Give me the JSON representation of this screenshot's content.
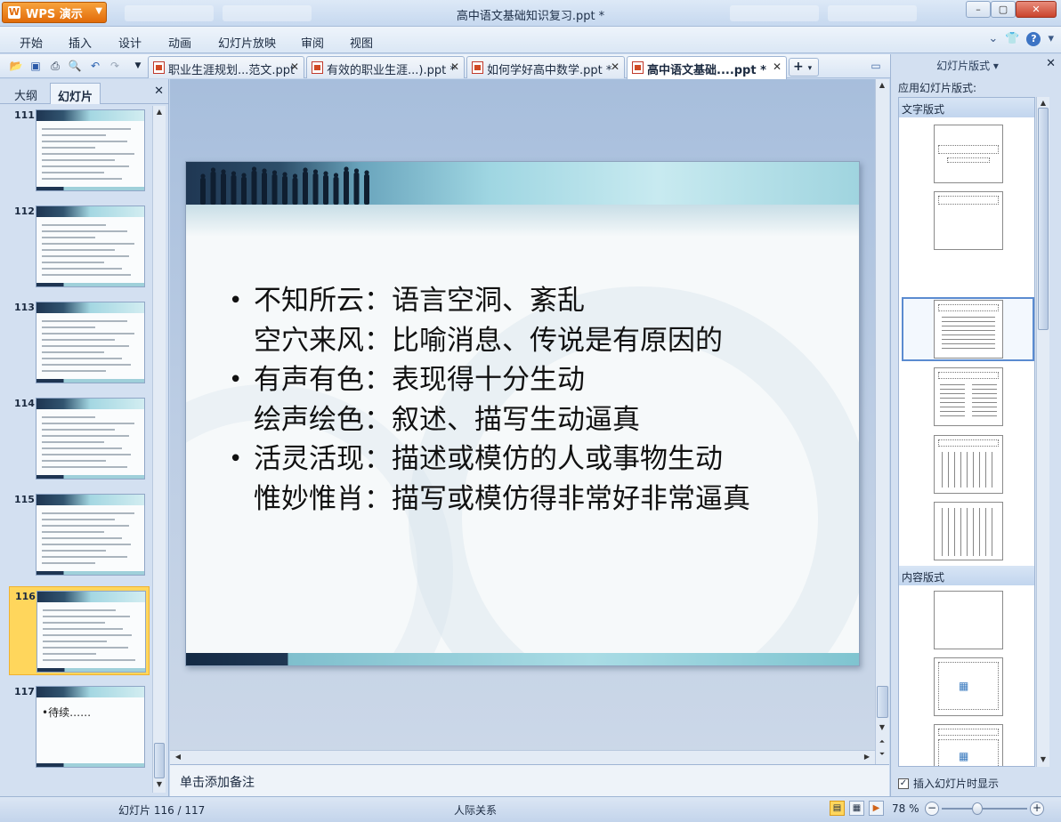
{
  "app": {
    "brand": "WPS 演示",
    "window_title": "高中语文基础知识复习.ppt *"
  },
  "window_controls": {
    "minimize": "–",
    "restore": "▢",
    "close": "✕"
  },
  "menu": {
    "items": [
      "开始",
      "插入",
      "设计",
      "动画",
      "幻灯片放映",
      "审阅",
      "视图"
    ]
  },
  "doc_tabs": [
    {
      "label": "职业生涯规划...范文.ppt",
      "active": false
    },
    {
      "label": "有效的职业生涯...).ppt *",
      "active": false
    },
    {
      "label": "如何学好高中数学.ppt *",
      "active": false
    },
    {
      "label": "高中语文基础....ppt *",
      "active": true
    }
  ],
  "left_panel": {
    "tabs": [
      "大纲",
      "幻灯片"
    ],
    "active_tab": "幻灯片",
    "thumbnails": [
      {
        "number": "111",
        "selected": false,
        "text": ""
      },
      {
        "number": "112",
        "selected": false,
        "text": ""
      },
      {
        "number": "113",
        "selected": false,
        "text": ""
      },
      {
        "number": "114",
        "selected": false,
        "text": ""
      },
      {
        "number": "115",
        "selected": false,
        "text": ""
      },
      {
        "number": "116",
        "selected": true,
        "text": ""
      },
      {
        "number": "117",
        "selected": false,
        "text": "•待续……"
      }
    ]
  },
  "slide": {
    "bullets": [
      {
        "bullet": true,
        "text": "不知所云：语言空洞、紊乱"
      },
      {
        "bullet": false,
        "text": "空穴来风：比喻消息、传说是有原因的"
      },
      {
        "bullet": true,
        "text": "有声有色：表现得十分生动"
      },
      {
        "bullet": false,
        "text": "绘声绘色：叙述、描写生动逼真"
      },
      {
        "bullet": true,
        "text": "活灵活现：描述或模仿的人或事物生动"
      },
      {
        "bullet": false,
        "text": "惟妙惟肖：描写或模仿得非常好非常逼真"
      }
    ]
  },
  "notes": {
    "placeholder": "单击添加备注"
  },
  "task_pane": {
    "title": "幻灯片版式 ▾",
    "apply_label": "应用幻灯片版式:",
    "sections": [
      "文字版式",
      "内容版式"
    ],
    "show_on_insert_label": "插入幻灯片时显示",
    "show_on_insert_checked": true
  },
  "status": {
    "slide_indicator": "幻灯片 116 / 117",
    "theme": "人际关系",
    "zoom": "78 %",
    "zoom_fraction": 0.42
  },
  "colors": {
    "wps_orange": "#e26b09",
    "selection_yellow": "#ffd65c",
    "chrome_blue": "#c9d9ee"
  }
}
